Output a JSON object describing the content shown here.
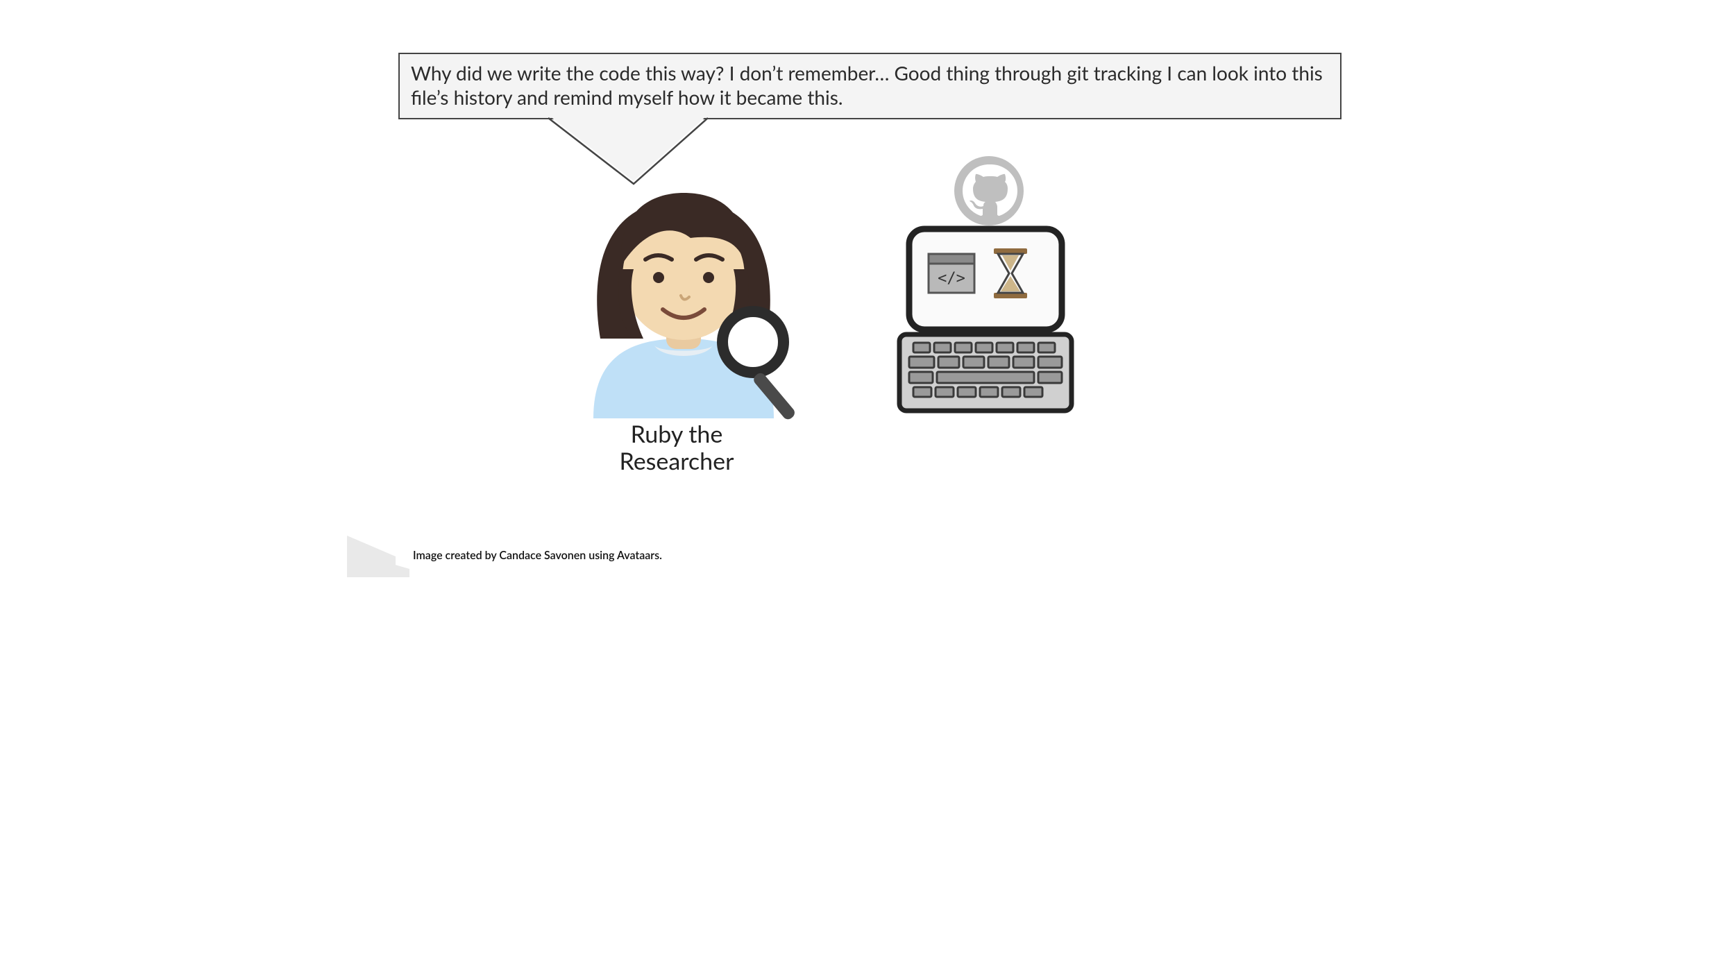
{
  "speech_text": "Why did we write the code this way? I don’t remember… Good thing through git tracking I can look into this file’s history and remind myself how it became this.",
  "persona_name": "Ruby the Researcher",
  "credit_text": "Image created by Candace Savonen using Avataars.",
  "icons": {
    "github": "github-icon",
    "code_window": "code-window-icon",
    "hourglass": "hourglass-icon",
    "magnifier": "magnifying-glass-icon",
    "laptop": "laptop-icon"
  },
  "colors": {
    "speech_bg": "#f4f4f4",
    "speech_border": "#444444",
    "shirt": "#bfe0f7",
    "hair": "#3a2a25",
    "skin": "#f3d9b1",
    "accent_brown": "#8f6b3f"
  }
}
